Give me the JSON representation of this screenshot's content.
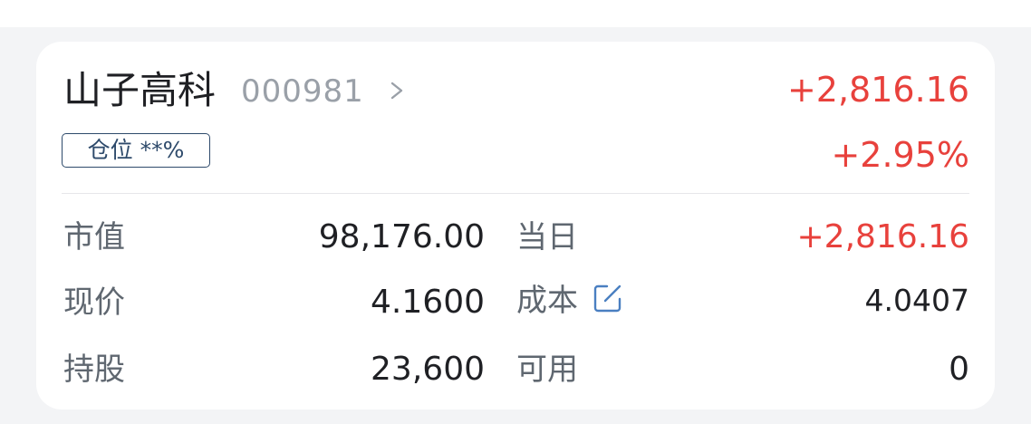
{
  "stock": {
    "name": "山子高科",
    "code": "000981",
    "position_label": "仓位 **%",
    "profit_loss": "+2,816.16",
    "profit_loss_pct": "+2.95%"
  },
  "details": {
    "market_value": {
      "label": "市值",
      "value": "98,176.00"
    },
    "today_pnl": {
      "label": "当日",
      "value": "+2,816.16"
    },
    "current_price": {
      "label": "现价",
      "value": "4.1600"
    },
    "cost": {
      "label": "成本",
      "value": "4.0407"
    },
    "holdings": {
      "label": "持股",
      "value": "23,600"
    },
    "available": {
      "label": "可用",
      "value": "0"
    }
  },
  "colors": {
    "gain": "#e8413c",
    "badge_border": "#2e4a6b",
    "edit_icon": "#4a7fc1"
  },
  "icons": {
    "detail": "chevron-right-icon",
    "edit_cost": "edit-icon"
  }
}
